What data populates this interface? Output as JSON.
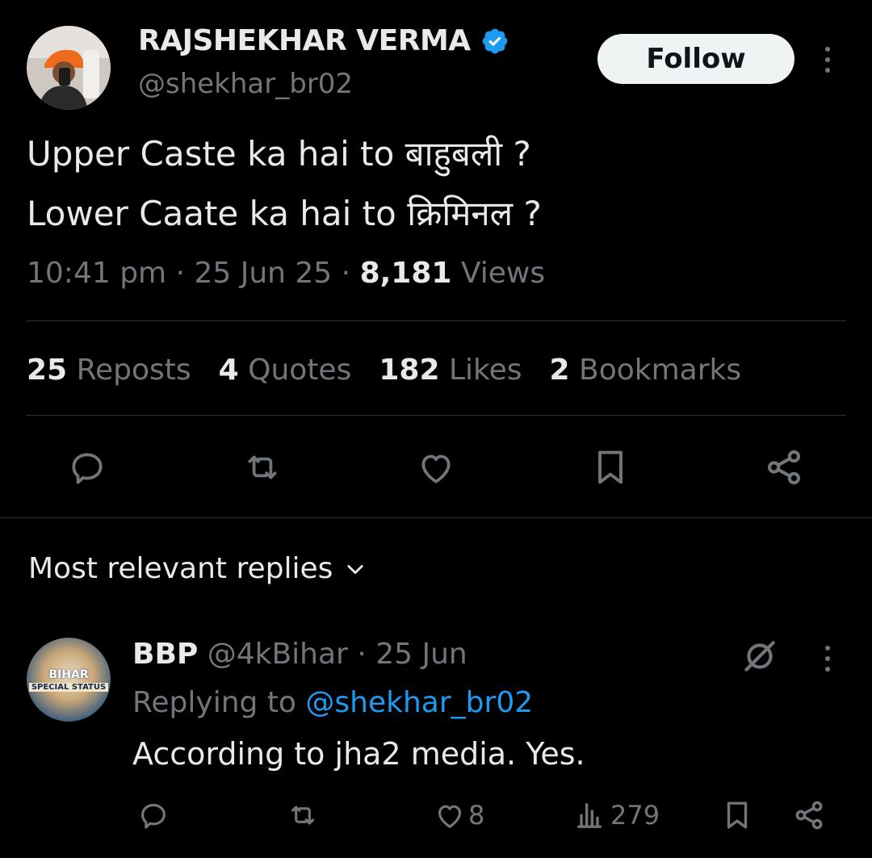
{
  "author": {
    "name": "RAJSHEKHAR VERMA",
    "handle": "@shekhar_br02",
    "verified": true,
    "verified_color": "#1d9bf0"
  },
  "follow_label": "Follow",
  "tweet": {
    "line1": "Upper Caste ka hai to बाहुबली ?",
    "line2": "Lower Caate ka hai to क्रिमिनल ?",
    "time": "10:41 pm",
    "date": "25 Jun 25",
    "views_count": "8,181",
    "views_label": "Views"
  },
  "stats": {
    "reposts_count": "25",
    "reposts_label": "Reposts",
    "quotes_count": "4",
    "quotes_label": "Quotes",
    "likes_count": "182",
    "likes_label": "Likes",
    "bookmarks_count": "2",
    "bookmarks_label": "Bookmarks"
  },
  "action_icons": [
    "reply-icon",
    "repost-icon",
    "like-icon",
    "bookmark-icon",
    "share-icon"
  ],
  "replies_sort_label": "Most relevant replies",
  "reply": {
    "name": "BBP",
    "handle": "@4kBihar",
    "date": "25 Jun",
    "replying_prefix": "Replying to",
    "replying_handle": "@shekhar_br02",
    "text": "According to jha2 media. Yes.",
    "avatar_text1": "BIHAR",
    "avatar_text2": "SPECIAL STATUS",
    "likes": "8",
    "views": "279"
  },
  "colors": {
    "background": "#000000",
    "text_primary": "#e7e9ea",
    "text_secondary": "#71767b",
    "accent": "#1d9bf0",
    "divider": "#2f3336"
  }
}
